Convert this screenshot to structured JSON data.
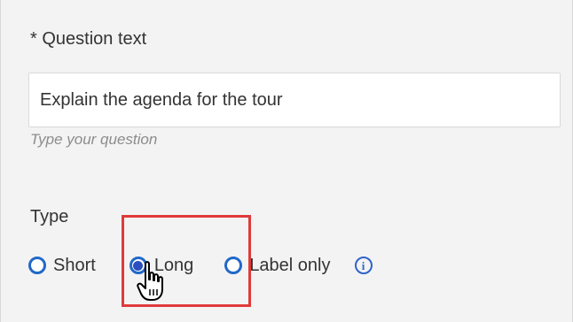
{
  "question": {
    "label": "* Question text",
    "value": "Explain the agenda for the tour",
    "placeholder": "Type your question",
    "hint": "Type your question"
  },
  "type": {
    "label": "Type",
    "options": [
      {
        "label": "Short",
        "selected": false
      },
      {
        "label": "Long",
        "selected": true
      },
      {
        "label": "Label only",
        "selected": false
      }
    ],
    "info_icon": "info-icon"
  },
  "colors": {
    "accent": "#2168c9",
    "highlight": "#e03a3a",
    "background": "#f3f3f3"
  }
}
